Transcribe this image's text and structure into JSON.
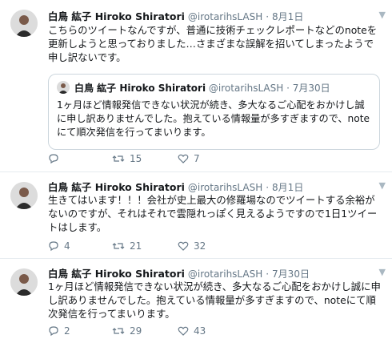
{
  "tweets": [
    {
      "name": "白鳥 紘子 Hiroko Shiratori",
      "handle": "@irotarihsLASH",
      "time": "8月1日",
      "body": "こちらのツイートなんですが、普通に技術チェックレポートなどのnoteを\n更新しようと思っておりました…さまざまな誤解を招いてしまったようで\n申し訳ないです。",
      "quote": {
        "name": "白鳥 紘子 Hiroko Shiratori",
        "handle": "@irotarihsLASH",
        "time": "7月30日",
        "body": "1ヶ月ほど情報発信できない状況が続き、多大なるご心配をおかけし誠\nに申し訳ありませんでした。抱えている情報量が多すぎますので、note\nにて順次発信を行ってまいります。"
      },
      "replies": "",
      "retweets": "15",
      "likes": "7"
    },
    {
      "name": "白鳥 紘子 Hiroko Shiratori",
      "handle": "@irotarihsLASH",
      "time": "8月1日",
      "body": "生きてはいます！！！会社が史上最大の修羅場なのでツイートする余裕が\nないのですが、それはそれで雲隠れっぽく見えるようですので1日1ツイー\nトはします。",
      "replies": "4",
      "retweets": "21",
      "likes": "32"
    },
    {
      "name": "白鳥 紘子 Hiroko Shiratori",
      "handle": "@irotarihsLASH",
      "time": "7月30日",
      "body": "1ヶ月ほど情報発信できない状況が続き、多大なるご心配をおかけし誠に申\nし訳ありませんでした。抱えている情報量が多すぎますので、noteにて順\n次発信を行ってまいります。",
      "replies": "2",
      "retweets": "29",
      "likes": "43"
    }
  ],
  "separator": "·",
  "icons": {
    "reply": "reply-icon",
    "retweet": "retweet-icon",
    "like": "heart-icon",
    "more": "chevron-down-icon"
  },
  "colors": {
    "text": "#14171a",
    "muted": "#657786",
    "border": "#e6ecf0"
  }
}
